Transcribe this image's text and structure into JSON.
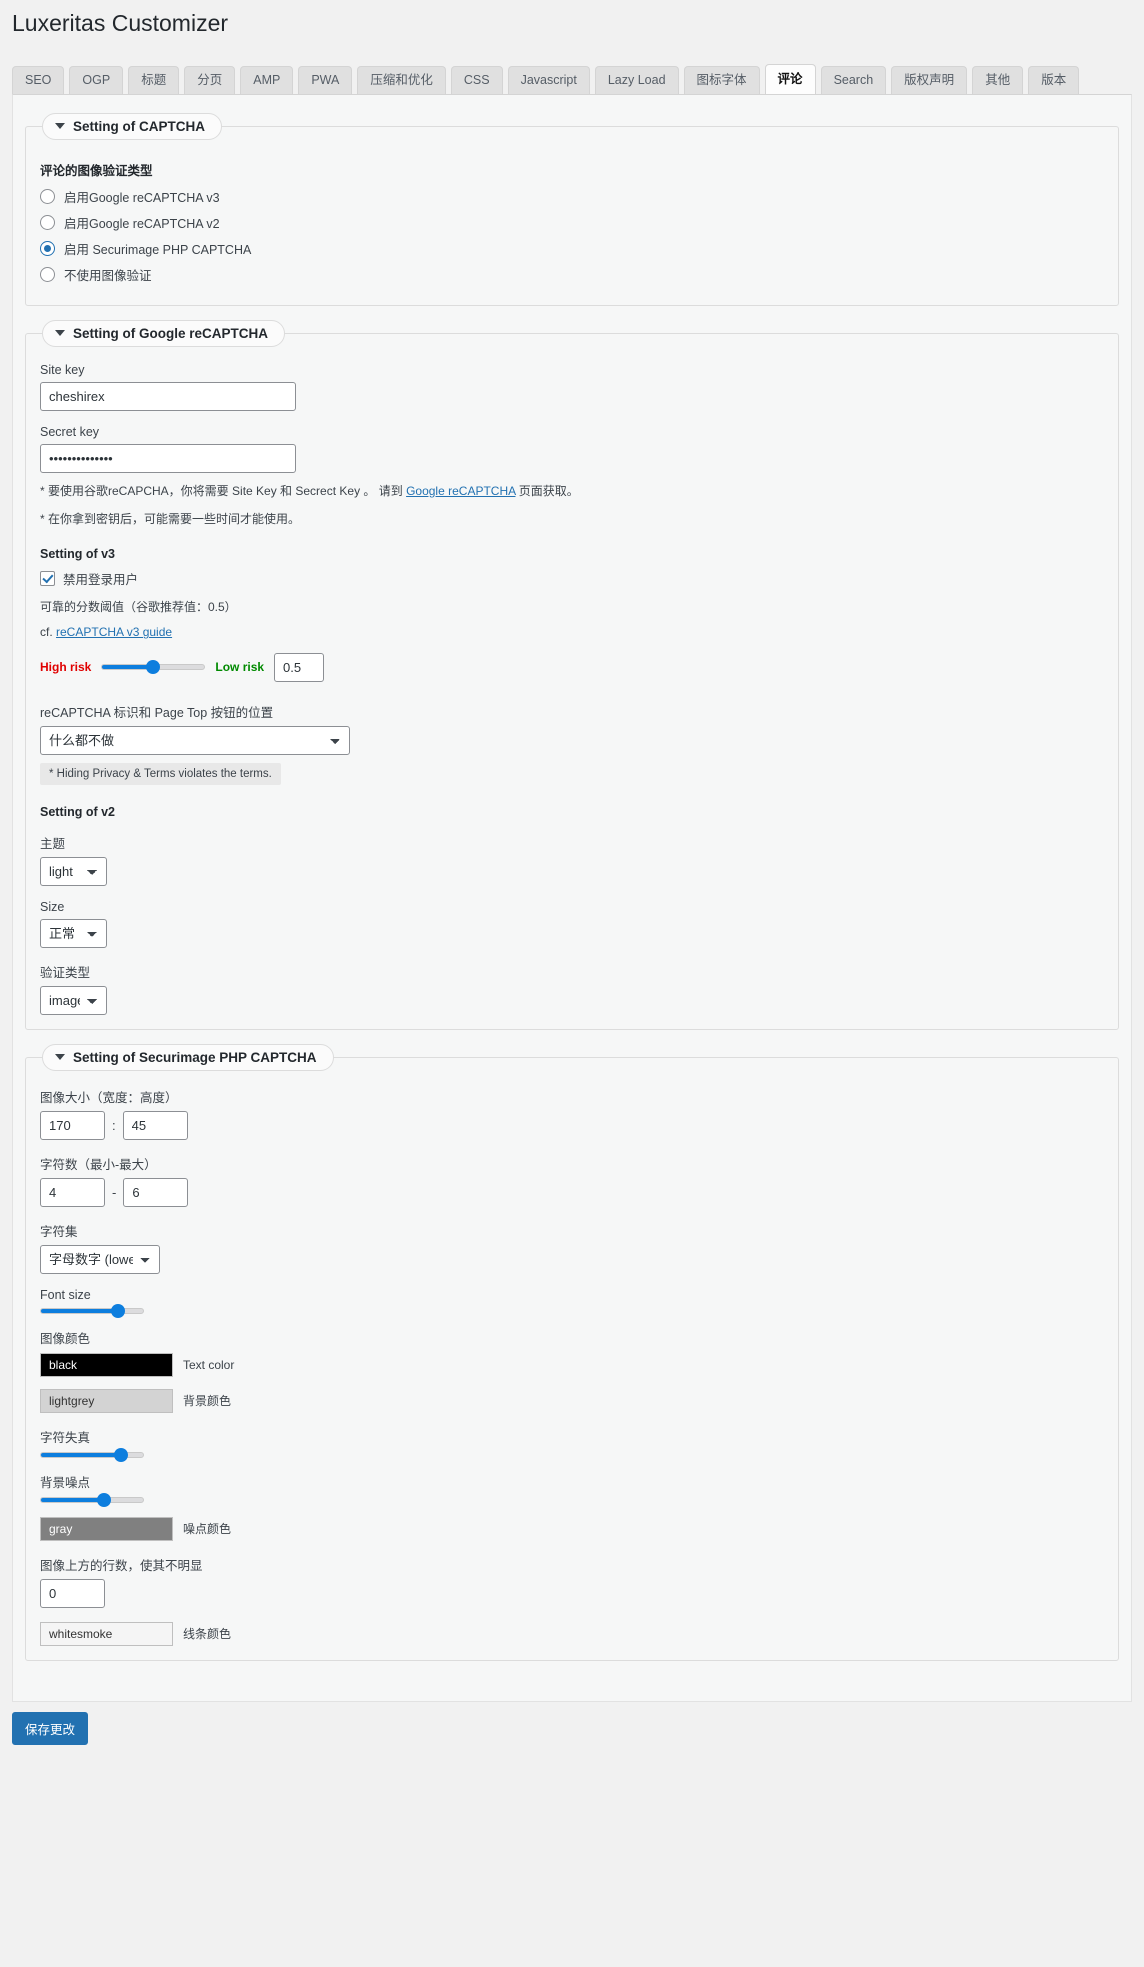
{
  "header": {
    "title": "Luxeritas Customizer"
  },
  "tabs": [
    {
      "label": "SEO",
      "active": false
    },
    {
      "label": "OGP",
      "active": false
    },
    {
      "label": "标题",
      "active": false
    },
    {
      "label": "分页",
      "active": false
    },
    {
      "label": "AMP",
      "active": false
    },
    {
      "label": "PWA",
      "active": false
    },
    {
      "label": "压缩和优化",
      "active": false
    },
    {
      "label": "CSS",
      "active": false
    },
    {
      "label": "Javascript",
      "active": false
    },
    {
      "label": "Lazy Load",
      "active": false
    },
    {
      "label": "图标字体",
      "active": false
    },
    {
      "label": "评论",
      "active": true
    },
    {
      "label": "Search",
      "active": false
    },
    {
      "label": "版权声明",
      "active": false
    },
    {
      "label": "其他",
      "active": false
    },
    {
      "label": "版本",
      "active": false
    }
  ],
  "captcha_section": {
    "legend": "Setting of CAPTCHA",
    "group_label": "评论的图像验证类型",
    "options": [
      {
        "label": "启用Google reCAPTCHA v3",
        "selected": false
      },
      {
        "label": "启用Google reCAPTCHA v2",
        "selected": false
      },
      {
        "label": "启用 Securimage PHP CAPTCHA",
        "selected": true
      },
      {
        "label": "不使用图像验证",
        "selected": false
      }
    ]
  },
  "recaptcha_section": {
    "legend": "Setting of Google reCAPTCHA",
    "site_key_label": "Site key",
    "site_key_value": "cheshirex",
    "secret_key_label": "Secret key",
    "secret_key_value": "••••••••••••••",
    "note1_pre": "* 要使用谷歌reCAPCHA，你将需要 Site Key 和 Secrect Key 。 请到 ",
    "note1_link": "Google reCAPTCHA",
    "note1_post": " 页面获取。",
    "note2": "* 在你拿到密钥后，可能需要一些时间才能使用。",
    "v3_title": "Setting of v3",
    "v3_checkbox_label": "禁用登录用户",
    "v3_checkbox_checked": true,
    "threshold_label": "可靠的分数阈值（谷歌推荐值：0.5）",
    "guide_prefix": "cf. ",
    "guide_link": "reCAPTCHA v3 guide",
    "risk_high": "High risk",
    "risk_low": "Low risk",
    "threshold_value": "0.5",
    "threshold_percent": 50,
    "badge_label": "reCAPTCHA 标识和 Page Top 按钮的位置",
    "badge_value": "什么都不做",
    "badge_options": [
      "什么都不做"
    ],
    "badge_hint": "* Hiding Privacy & Terms violates the terms.",
    "v2_title": "Setting of v2",
    "theme_label": "主题",
    "theme_value": "light",
    "theme_options": [
      "light"
    ],
    "size_label": "Size",
    "size_value": "正常",
    "size_options": [
      "正常"
    ],
    "type_label": "验证类型",
    "type_value": "image",
    "type_options": [
      "image"
    ]
  },
  "securimage_section": {
    "legend": "Setting of Securimage PHP CAPTCHA",
    "image_size_label": "图像大小（宽度：高度）",
    "image_width": "170",
    "image_height": "45",
    "size_separator": ":",
    "chars_label": "字符数（最小-最大）",
    "chars_min": "4",
    "chars_max": "6",
    "chars_separator": "-",
    "charset_label": "字符集",
    "charset_value": "字母数字 (lower)",
    "charset_options": [
      "字母数字 (lower)"
    ],
    "font_size_label": "Font size",
    "font_size_percent": 75,
    "image_color_label": "图像颜色",
    "text_color_value": "black",
    "text_color_caption": "Text color",
    "text_color_hex": "#000000",
    "bg_color_value": "lightgrey",
    "bg_color_caption": "背景颜色",
    "bg_color_hex": "#d3d3d3",
    "distortion_label": "字符失真",
    "distortion_percent": 78,
    "noise_label": "背景噪点",
    "noise_percent": 62,
    "noise_color_value": "gray",
    "noise_color_caption": "噪点颜色",
    "noise_color_hex": "#808080",
    "lines_label": "图像上方的行数，使其不明显",
    "lines_value": "0",
    "line_color_value": "whitesmoke",
    "line_color_caption": "线条颜色",
    "line_color_hex": "#f5f5f5"
  },
  "footer": {
    "save_label": "保存更改"
  }
}
